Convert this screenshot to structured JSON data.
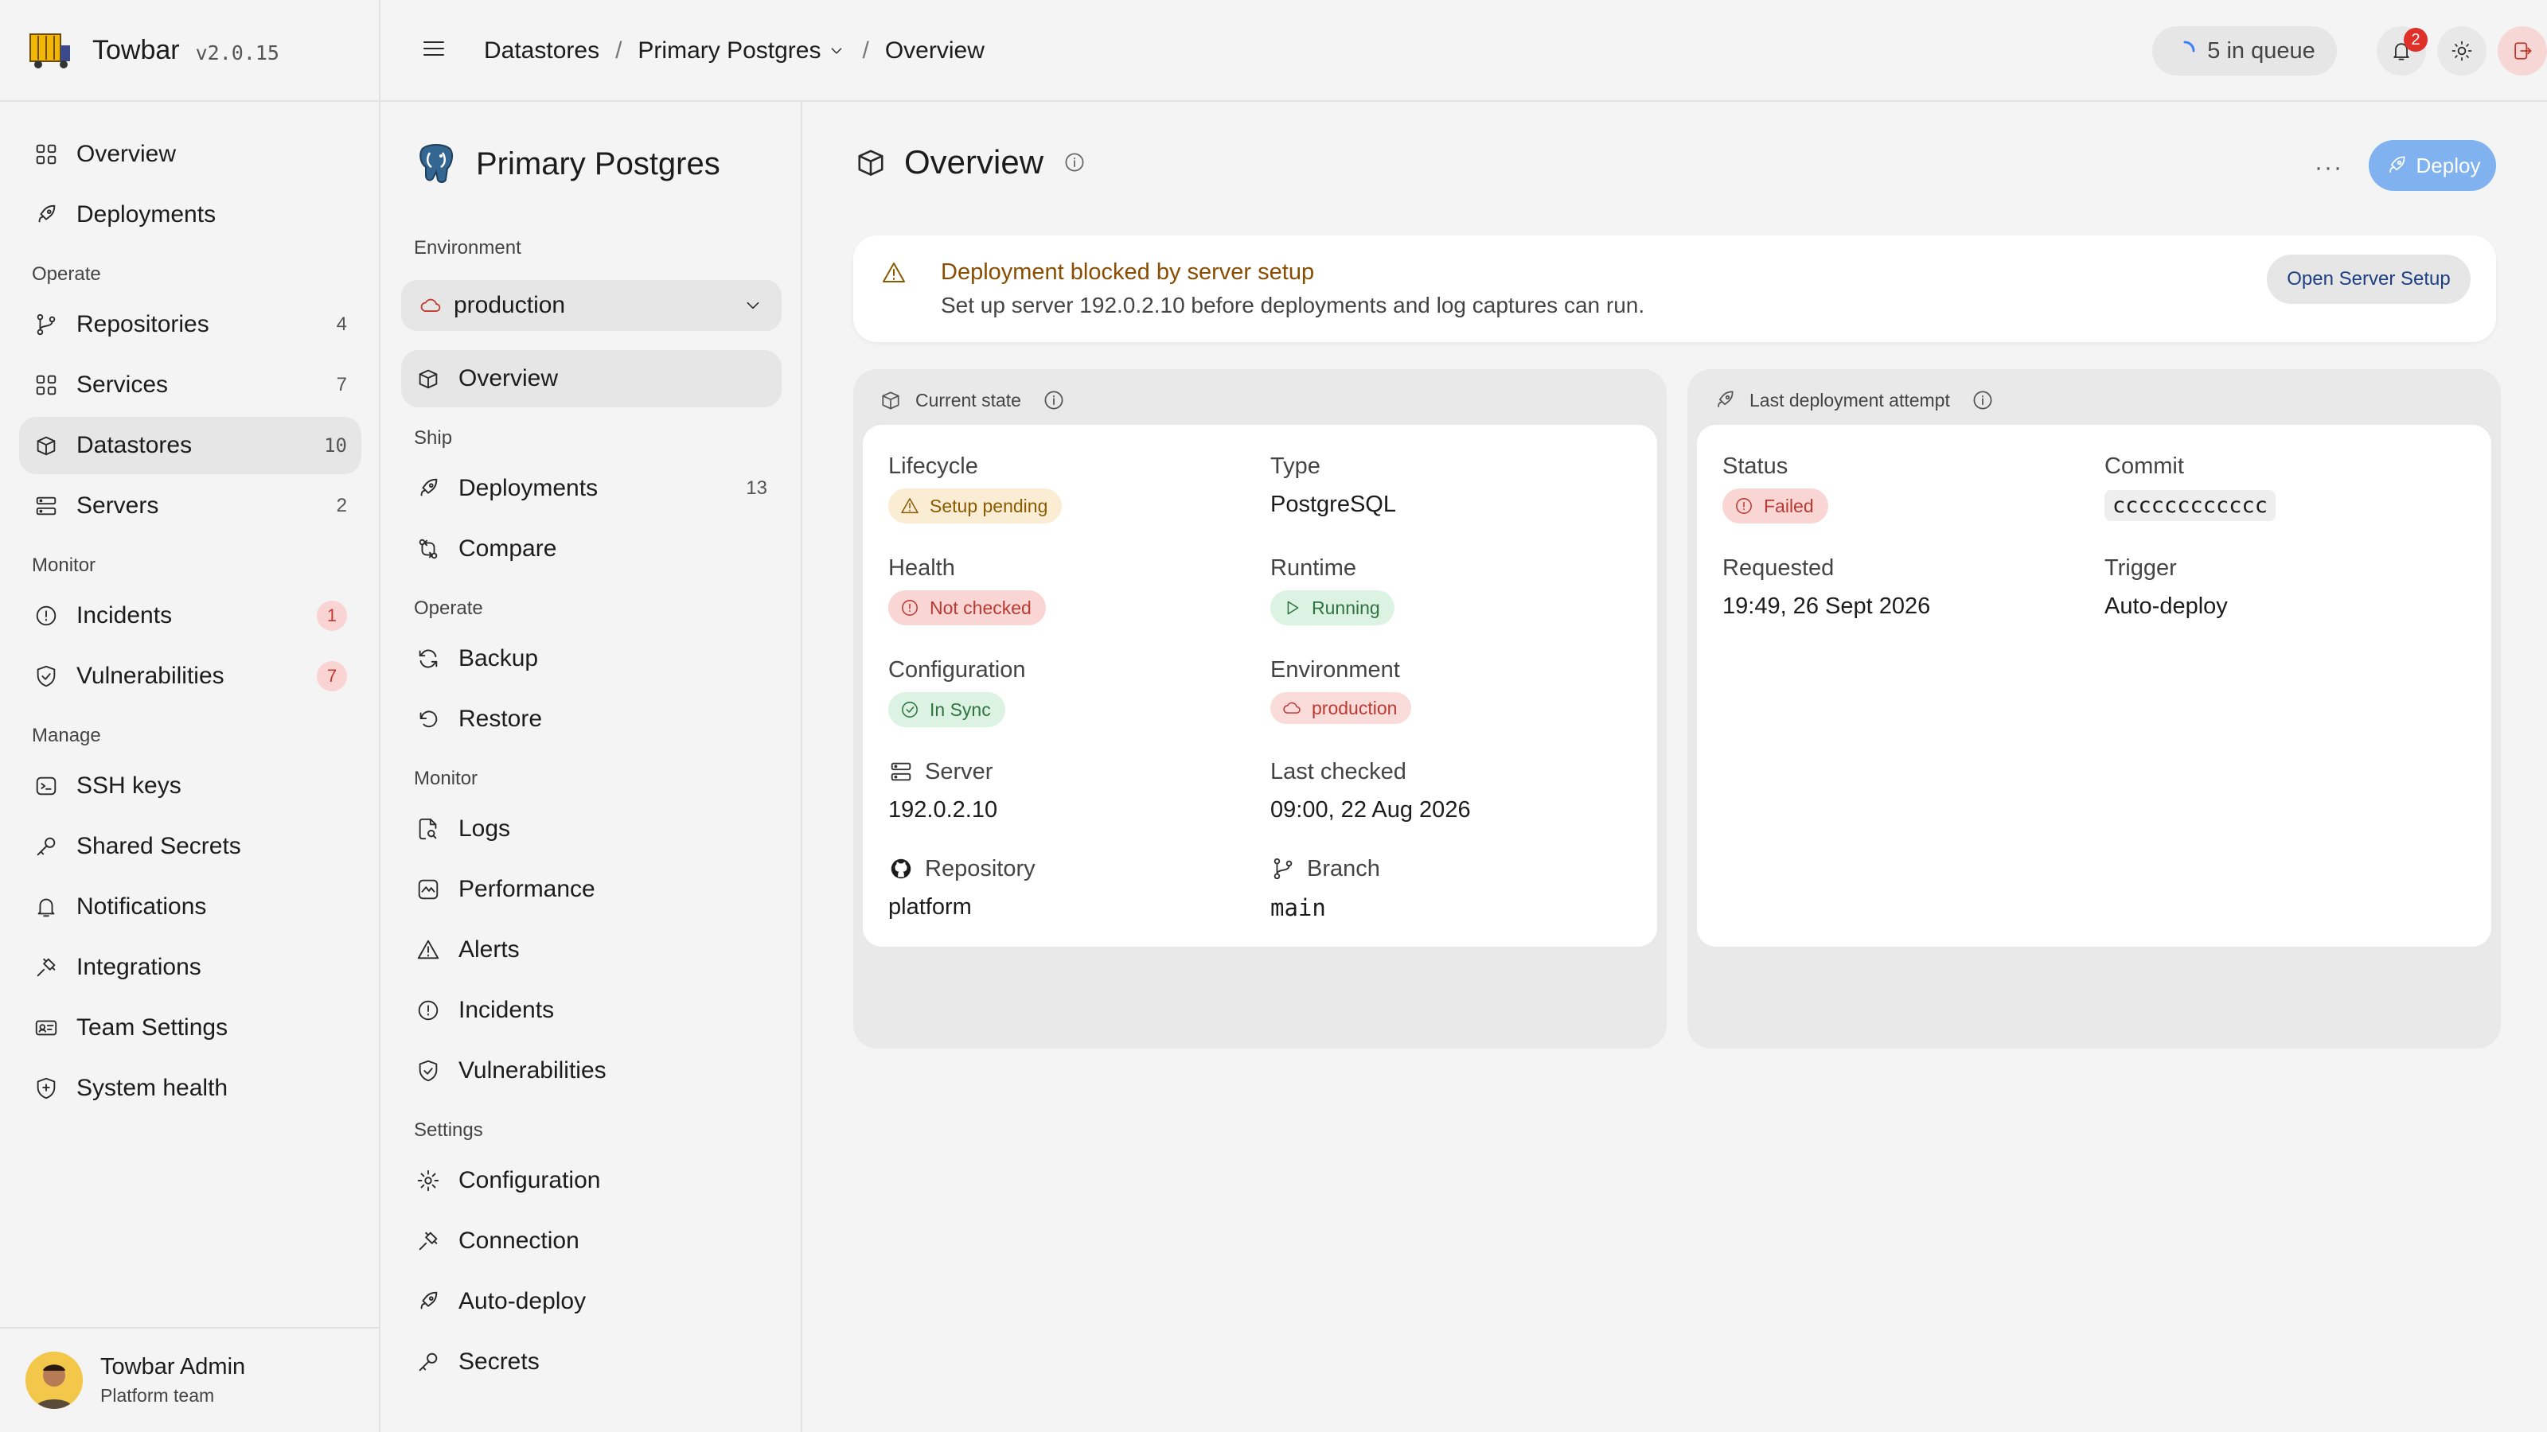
{
  "app": {
    "name": "Towbar",
    "version": "v2.0.15"
  },
  "sidebar": {
    "top": [
      {
        "label": "Overview",
        "icon": "grid-icon"
      },
      {
        "label": "Deployments",
        "icon": "rocket-icon"
      }
    ],
    "sections": [
      {
        "title": "Operate",
        "items": [
          {
            "label": "Repositories",
            "count": "4",
            "icon": "git-branch-icon"
          },
          {
            "label": "Services",
            "count": "7",
            "icon": "grid-icon"
          },
          {
            "label": "Datastores",
            "count": "10",
            "icon": "box-icon",
            "active": true
          },
          {
            "label": "Servers",
            "count": "2",
            "icon": "server-icon"
          }
        ]
      },
      {
        "title": "Monitor",
        "items": [
          {
            "label": "Incidents",
            "count": "1",
            "icon": "alert-circle-icon"
          },
          {
            "label": "Vulnerabilities",
            "count": "7",
            "icon": "shield-icon"
          }
        ]
      },
      {
        "title": "Manage",
        "items": [
          {
            "label": "SSH keys"
          },
          {
            "label": "Shared Secrets"
          },
          {
            "label": "Notifications"
          },
          {
            "label": "Integrations"
          },
          {
            "label": "Team Settings"
          },
          {
            "label": "System health"
          }
        ]
      }
    ],
    "user": {
      "name": "Towbar Admin",
      "team": "Platform team"
    }
  },
  "header": {
    "breadcrumb": [
      "Datastores",
      "Primary Postgres",
      "Overview"
    ],
    "separator": "/",
    "queue": "5 in queue",
    "notifications_count": "2"
  },
  "subnav": {
    "title": "Primary Postgres",
    "env_label": "Environment",
    "env_value": "production",
    "overview": "Overview",
    "ship_title": "Ship",
    "ship": [
      {
        "label": "Deployments",
        "count": "13"
      },
      {
        "label": "Compare"
      }
    ],
    "operate_title": "Operate",
    "operate": [
      "Backup",
      "Restore"
    ],
    "monitor_title": "Monitor",
    "monitor": [
      "Logs",
      "Performance",
      "Alerts",
      "Incidents",
      "Vulnerabilities"
    ],
    "settings_title": "Settings",
    "settings": [
      "Configuration",
      "Connection",
      "Auto-deploy",
      "Secrets"
    ]
  },
  "main": {
    "title": "Overview",
    "more": "···",
    "deploy_label": "Deploy",
    "alert": {
      "title": "Deployment blocked by server setup",
      "detail": "Set up server 192.0.2.10 before deployments and log captures can run.",
      "action": "Open Server Setup"
    },
    "current_state": {
      "title": "Current state",
      "lifecycle_k": "Lifecycle",
      "lifecycle_v": "Setup pending",
      "type_k": "Type",
      "type_v": "PostgreSQL",
      "health_k": "Health",
      "health_v": "Not checked",
      "runtime_k": "Runtime",
      "runtime_v": "Running",
      "config_k": "Configuration",
      "config_v": "In Sync",
      "env_k": "Environment",
      "env_v": "production",
      "server_k": "Server",
      "server_v": "192.0.2.10",
      "checked_k": "Last checked",
      "checked_v": "09:00, 22 Aug 2026",
      "repo_k": "Repository",
      "repo_v": "platform",
      "branch_k": "Branch",
      "branch_v": "main"
    },
    "last_deploy": {
      "title": "Last deployment attempt",
      "status_k": "Status",
      "status_v": "Failed",
      "commit_k": "Commit",
      "commit_v": "cccccccccccc",
      "requested_k": "Requested",
      "requested_v": "19:49, 26 Sept 2026",
      "trigger_k": "Trigger",
      "trigger_v": "Auto-deploy"
    }
  },
  "colors": {
    "accent": "#7fb2ee",
    "danger": "#e0302a",
    "warning": "#8a5a00",
    "success": "#2f7440"
  }
}
